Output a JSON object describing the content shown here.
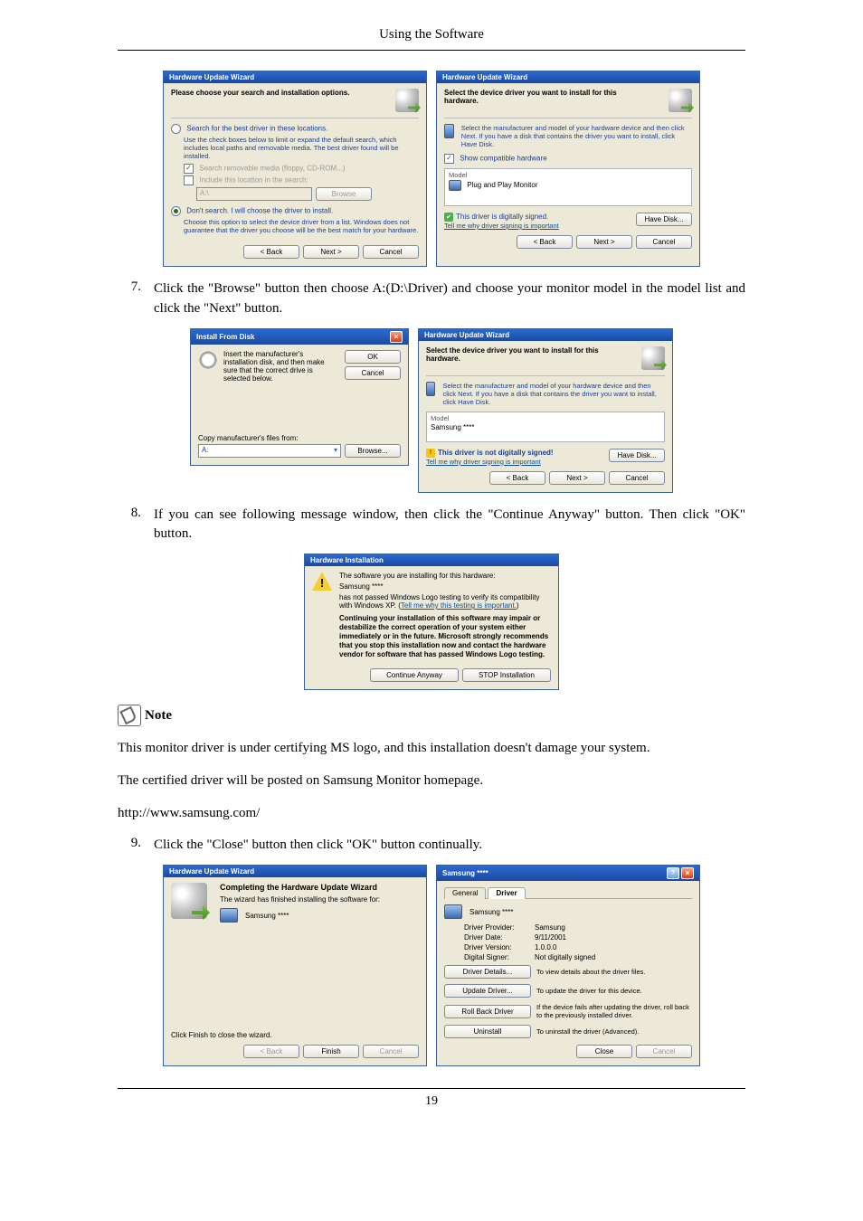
{
  "page_header": "Using the Software",
  "page_number": "19",
  "huw_title": "Hardware Update Wizard",
  "step7": {
    "num": "7.",
    "text": "Click the \"Browse\" button then choose A:(D:\\Driver) and choose your monitor model in the model list and click the \"Next\" button."
  },
  "step8": {
    "num": "8.",
    "text": "If you can see following message window, then click the \"Continue Anyway\" button. Then click \"OK\" button."
  },
  "step9": {
    "num": "9.",
    "text": "Click the \"Close\" button then click \"OK\" button continually."
  },
  "note_label": "Note",
  "note_p1": "This monitor driver is under certifying MS logo, and this installation doesn't damage your system.",
  "note_p2": "The certified driver will be posted on Samsung Monitor homepage.",
  "note_url": "http://www.samsung.com/",
  "dlg1": {
    "head": "Please choose your search and installation options.",
    "r1": "Search for the best driver in these locations.",
    "r1_desc": "Use the check boxes below to limit or expand the default search, which includes local paths and removable media. The best driver found will be installed.",
    "c1": "Search removable media (floppy, CD-ROM...)",
    "c2": "Include this location in the search:",
    "path": "A:\\",
    "browse": "Browse",
    "r2": "Don't search. I will choose the driver to install.",
    "r2_desc": "Choose this option to select the device driver from a list. Windows does not guarantee that the driver you choose will be the best match for your hardware."
  },
  "dlg2": {
    "head": "Select the device driver you want to install for this hardware.",
    "desc": "Select the manufacturer and model of your hardware device and then click Next. If you have a disk that contains the driver you want to install, click Have Disk.",
    "chk": "Show compatible hardware",
    "model_lbl": "Model",
    "model_val": "Plug and Play Monitor",
    "signed": "This driver is digitally signed.",
    "tell": "Tell me why driver signing is important",
    "have_disk": "Have Disk..."
  },
  "btns": {
    "back": "< Back",
    "next": "Next >",
    "cancel": "Cancel",
    "ok": "OK",
    "finish": "Finish",
    "close": "Close"
  },
  "dlg3": {
    "title": "Install From Disk",
    "msg": "Insert the manufacturer's installation disk, and then make sure that the correct drive is selected below.",
    "copy_lbl": "Copy manufacturer's files from:",
    "path_val": "A:",
    "browse": "Browse..."
  },
  "dlg4": {
    "model_val": "Samsung ****",
    "signed": "This driver is not digitally signed!"
  },
  "dlg5": {
    "title": "Hardware Installation",
    "l1": "The software you are installing for this hardware:",
    "name": "Samsung ****",
    "l2": "has not passed Windows Logo testing to verify its compatibility with Windows XP. (",
    "l2_link": "Tell me why this testing is important.",
    "l2_end": ")",
    "warn": "Continuing your installation of this software may impair or destabilize the correct operation of your system either immediately or in the future. Microsoft strongly recommends that you stop this installation now and contact the hardware vendor for software that has passed Windows Logo testing.",
    "cont": "Continue Anyway",
    "stop": "STOP Installation"
  },
  "dlg6": {
    "head": "Completing the Hardware Update Wizard",
    "l1": "The wizard has finished installing the software for:",
    "name": "Samsung ****",
    "l2": "Click Finish to close the wizard."
  },
  "dlg7": {
    "title": "Samsung ****",
    "tab_general": "General",
    "tab_driver": "Driver",
    "name": "Samsung ****",
    "kv": {
      "prov_k": "Driver Provider:",
      "prov_v": "Samsung",
      "date_k": "Driver Date:",
      "date_v": "9/11/2001",
      "ver_k": "Driver Version:",
      "ver_v": "1.0.0.0",
      "sign_k": "Digital Signer:",
      "sign_v": "Not digitally signed"
    },
    "btns": {
      "details": "Driver Details...",
      "details_d": "To view details about the driver files.",
      "update": "Update Driver...",
      "update_d": "To update the driver for this device.",
      "roll": "Roll Back Driver",
      "roll_d": "If the device fails after updating the driver, roll back to the previously installed driver.",
      "uninst": "Uninstall",
      "uninst_d": "To uninstall the driver (Advanced)."
    }
  }
}
